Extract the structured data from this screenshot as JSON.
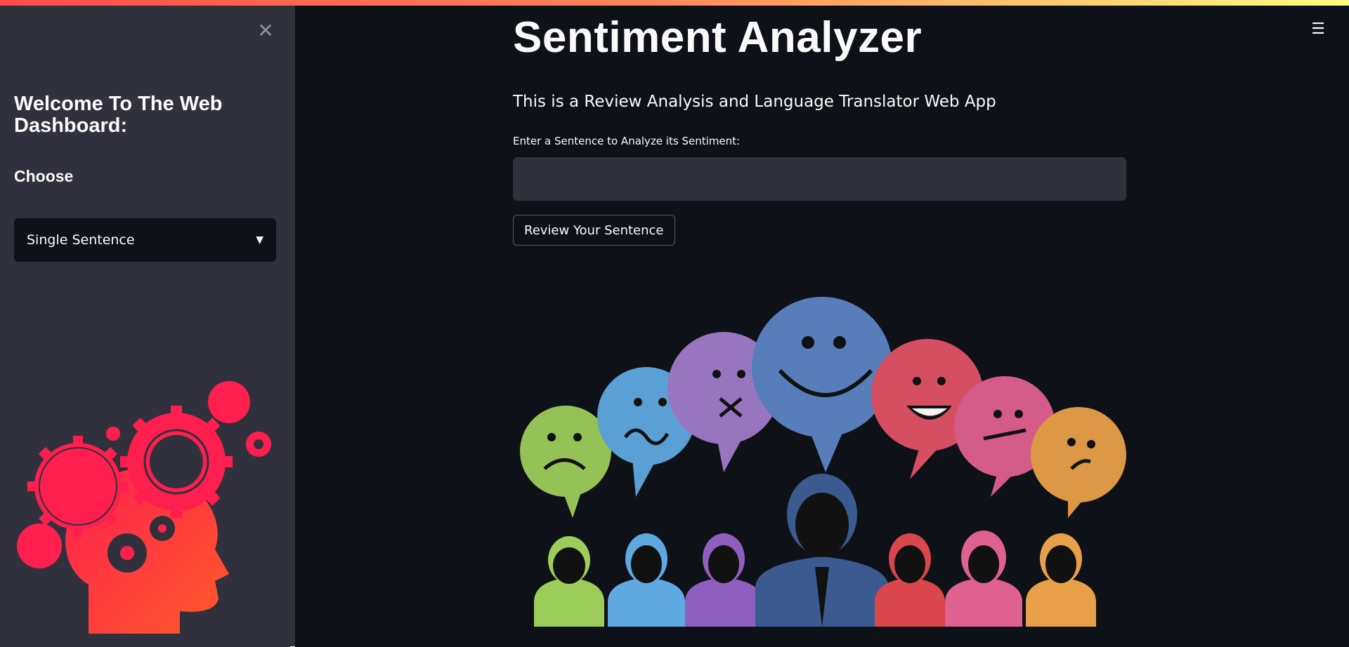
{
  "sidebar": {
    "close_icon": "close-icon",
    "title": "Welcome To The Web Dashboard:",
    "choose_label": "Choose",
    "select": {
      "value": "Single Sentence",
      "caret_icon": "caret-down-icon"
    },
    "illustration": "head-with-gears-illustration"
  },
  "header": {
    "menu_icon": "hamburger-menu-icon"
  },
  "main": {
    "title": "Sentiment Analyzer",
    "subtitle": "This is a Review Analysis and Language Translator Web App",
    "input_label": "Enter a Sentence to Analyze its Sentiment:",
    "input_value": "",
    "button_label": "Review Your Sentence",
    "illustration": "people-with-emotion-speech-bubbles"
  },
  "colors": {
    "background": "#0e1117",
    "sidebar": "#30313c",
    "accent": "#ff4b4b",
    "text": "#fafafa"
  }
}
